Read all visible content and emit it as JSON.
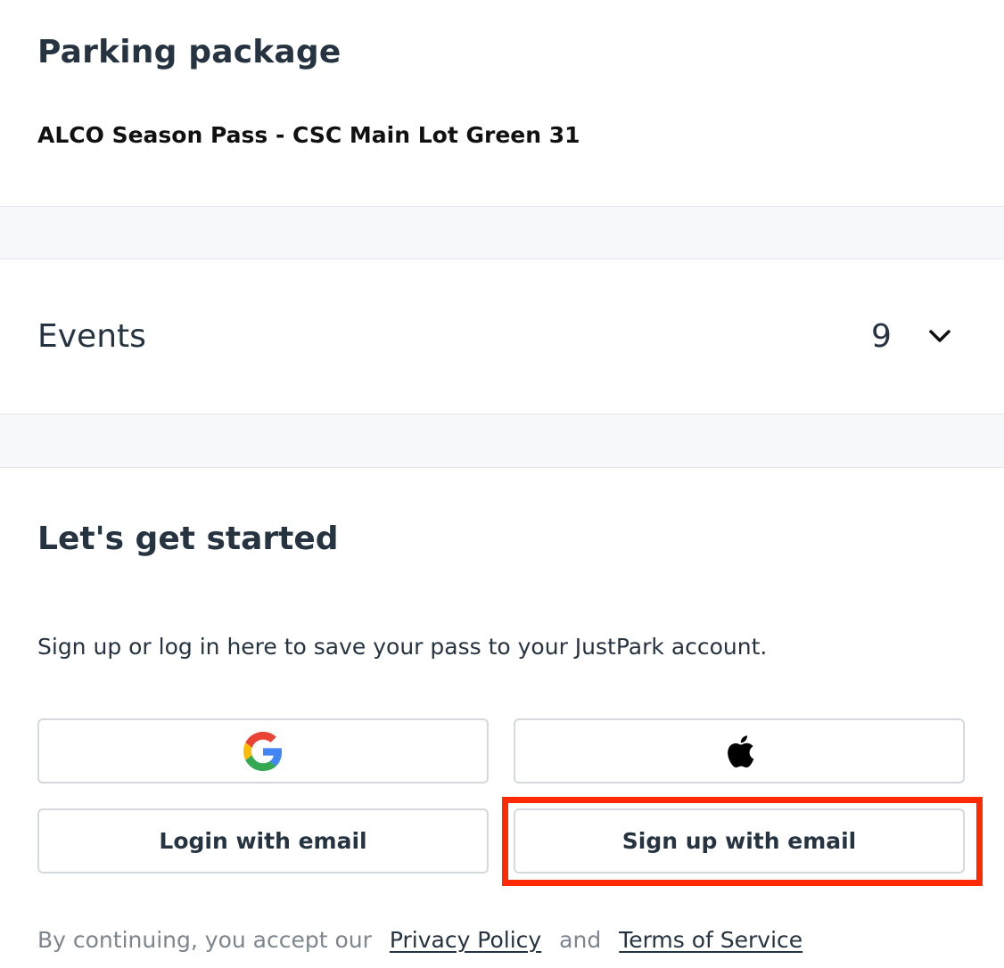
{
  "package": {
    "heading": "Parking package",
    "name": "ALCO Season Pass - CSC Main Lot Green 31"
  },
  "events": {
    "label": "Events",
    "count": "9",
    "toggle_icon": "chevron-down-icon"
  },
  "auth": {
    "heading": "Let's get started",
    "description": "Sign up or log in here to save your pass to your JustPark account.",
    "google_icon": "google-icon",
    "apple_icon": "apple-icon",
    "login_label": "Login with email",
    "signup_label": "Sign up with email"
  },
  "legal": {
    "prefix": "By continuing, you accept our",
    "privacy_link": "Privacy Policy",
    "conjunction": "and",
    "terms_link": "Terms of Service"
  },
  "colors": {
    "text_primary": "#263340",
    "text_muted": "#7d858f",
    "band_bg": "#f7f8fa",
    "button_border": "#d5d9de",
    "highlight": "#ff2a00"
  }
}
